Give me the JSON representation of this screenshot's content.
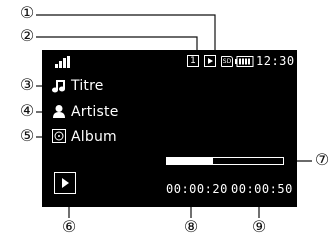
{
  "status_bar": {
    "playlist_number": "1",
    "memory_label": "SD",
    "time": "12:30"
  },
  "track": {
    "title": "Titre",
    "artist": "Artiste",
    "album": "Album"
  },
  "playback": {
    "elapsed": "00:00:20",
    "total": "00:00:50",
    "progress_fraction": 0.4
  },
  "callouts": [
    "①",
    "②",
    "③",
    "④",
    "⑤",
    "⑥",
    "⑦",
    "⑧",
    "⑨"
  ],
  "colors": {
    "screen_background": "#000000",
    "screen_foreground": "#ffffff",
    "leader_lines": "#111111"
  }
}
